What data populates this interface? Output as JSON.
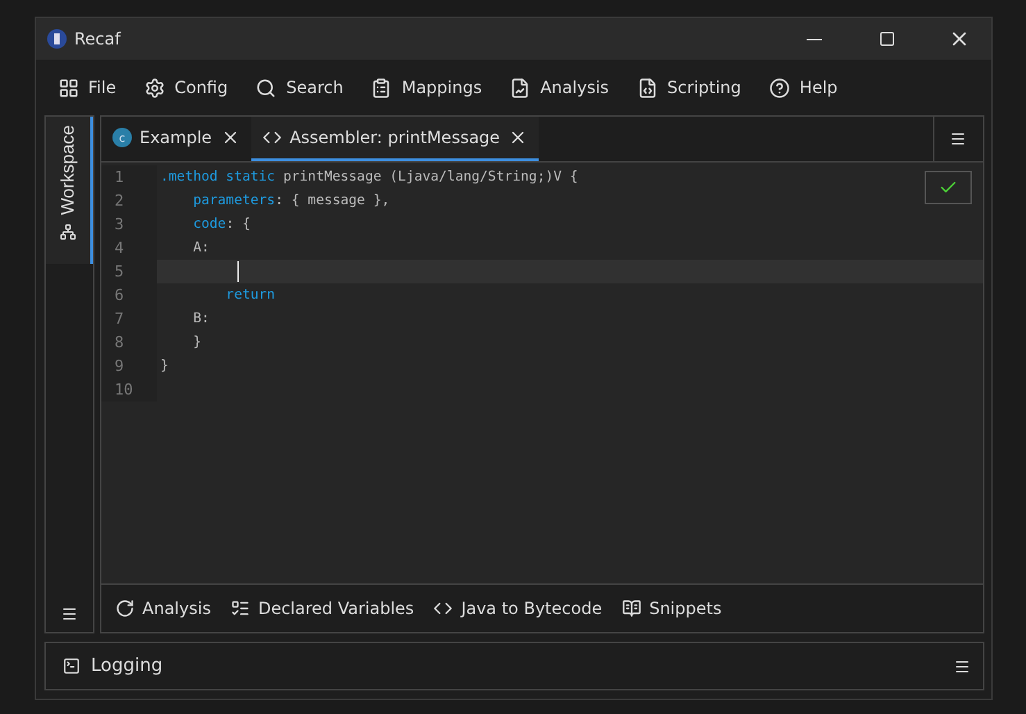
{
  "window": {
    "title": "Recaf"
  },
  "menu": [
    {
      "label": "File"
    },
    {
      "label": "Config"
    },
    {
      "label": "Search"
    },
    {
      "label": "Mappings"
    },
    {
      "label": "Analysis"
    },
    {
      "label": "Scripting"
    },
    {
      "label": "Help"
    }
  ],
  "sidebar": {
    "tabs": [
      {
        "label": "Workspace",
        "selected": true
      }
    ]
  },
  "tabs": [
    {
      "label": "Example",
      "kind": "class",
      "icon_letter": "c",
      "selected": false
    },
    {
      "label": "Assembler: printMessage",
      "kind": "code",
      "selected": true
    }
  ],
  "editor": {
    "lines": [
      {
        "number": "1",
        "current": false,
        "tokens": [
          {
            "text": ".method static",
            "kind": "keyword"
          },
          {
            "text": " printMessage (Ljava/lang/String;)V {",
            "kind": "plain"
          }
        ]
      },
      {
        "number": "2",
        "current": false,
        "tokens": [
          {
            "text": "    parameters",
            "kind": "keyword"
          },
          {
            "text": ": { message },",
            "kind": "plain"
          }
        ]
      },
      {
        "number": "3",
        "current": false,
        "tokens": [
          {
            "text": "    code",
            "kind": "keyword"
          },
          {
            "text": ": {",
            "kind": "plain"
          }
        ]
      },
      {
        "number": "4",
        "current": false,
        "tokens": [
          {
            "text": "    A:",
            "kind": "plain"
          }
        ]
      },
      {
        "number": "5",
        "current": true
      },
      {
        "number": "6",
        "current": false,
        "tokens": [
          {
            "text": "        return",
            "kind": "keyword"
          }
        ]
      },
      {
        "number": "7",
        "current": false,
        "tokens": [
          {
            "text": "    B:",
            "kind": "plain"
          }
        ]
      },
      {
        "number": "8",
        "current": false,
        "tokens": [
          {
            "text": "    }",
            "kind": "plain"
          }
        ]
      },
      {
        "number": "9",
        "current": false,
        "tokens": [
          {
            "text": "}",
            "kind": "plain"
          }
        ]
      },
      {
        "number": "10",
        "current": false
      }
    ],
    "valid": true
  },
  "bottom_tabs": [
    {
      "label": "Analysis"
    },
    {
      "label": "Declared Variables"
    },
    {
      "label": "Java to Bytecode"
    },
    {
      "label": "Snippets"
    }
  ],
  "logging": {
    "label": "Logging"
  }
}
